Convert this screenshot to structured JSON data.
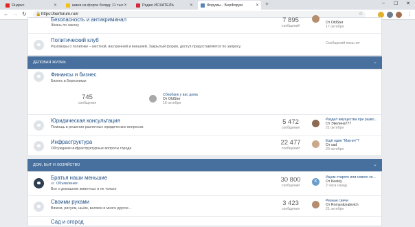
{
  "browser": {
    "tabs": [
      {
        "label": "Яндекс",
        "fav": "#e52620",
        "active": false
      },
      {
        "label": "швеи из форта боярд: 11 тыс",
        "fav": "#f4c20d",
        "active": false
      },
      {
        "label": "Радио ИСКАТЕЛЬ",
        "fav": "#d7263d",
        "active": false
      },
      {
        "label": "Форумы - БерФорум",
        "fav": "#5b84b1",
        "active": true
      }
    ],
    "url": "https://berforum.ru/#"
  },
  "top": {
    "partial_title": "Безопасность и антикриминал",
    "partial_desc": "Жизнь по закону",
    "partial_num": "7 895",
    "partial_lbl": "сообщений",
    "partial_from": "От OldSter",
    "partial_date": "17 октября",
    "politics_title": "Политический клуб",
    "politics_desc": "Разговоры о политике – местной, внутренней и внешней. Закрытый форум, доступ предоставляется по запросу.",
    "politics_last": "Сообщений пока нет"
  },
  "cat1": {
    "header": "Деловая жизнь",
    "finance_title": "Финансы и бизнес",
    "finance_desc": "Бизнес в Березниках",
    "finance_num": "745",
    "finance_lbl": "сообщения",
    "finance_last_title": "Сбербанк у вас дома",
    "finance_last_from": "От OldSter",
    "finance_last_date": "16 октября",
    "legal_title": "Юридическая консультация",
    "legal_desc": "Помощь в решении различных юридических вопросов.",
    "legal_num": "5 472",
    "legal_lbl": "сообщения",
    "legal_last_title": "Раздел имущества при разво...",
    "legal_last_from": "От Эвелина777",
    "legal_last_date": "21 октября",
    "infra_title": "Инфраструктура",
    "infra_desc": "Обсуждаем инфраструктурные вопросы города",
    "infra_num": "22 477",
    "infra_lbl": "сообщений",
    "infra_last_title": "Ещё один \"Магнит\"?",
    "infra_last_from": "От sad",
    "infra_last_date": "20 октября"
  },
  "cat2": {
    "header": "Дом, быт и хозяйство",
    "pets_title": "Братья наши меньшие",
    "pets_sub": "Объявления",
    "pets_desc": "Все о домашних животных и не только",
    "pets_num": "30 800",
    "pets_lbl": "сообщений",
    "pets_last_title": "Ищем старого или нового хо...",
    "pets_last_from": "От Keeley",
    "pets_last_date": "2 часа назад",
    "pets_avatar_letter": "K",
    "diy_title": "Своими руками",
    "diy_desc": "Вяжем, рисуем, шьём, валяем и много другое...",
    "diy_num": "3 423",
    "diy_lbl": "сообщения",
    "diy_last_title": "Резные свечи",
    "diy_last_from": "От Romantizralevich",
    "diy_last_date": "21 октября",
    "garden_title": "Сад и огород"
  }
}
